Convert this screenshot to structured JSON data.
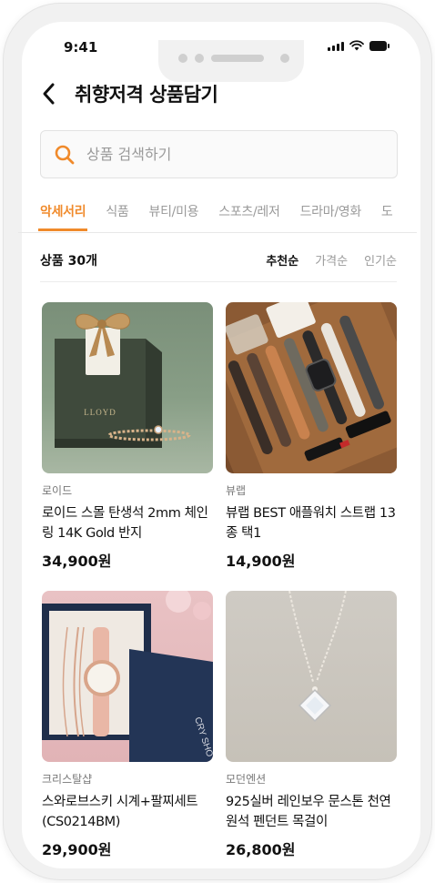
{
  "status_bar": {
    "time": "9:41"
  },
  "header": {
    "title": "취향저격 상품담기"
  },
  "search": {
    "placeholder": "상품 검색하기",
    "value": ""
  },
  "tabs": [
    {
      "label": "악세서리",
      "active": true
    },
    {
      "label": "식품",
      "active": false
    },
    {
      "label": "뷰티/미용",
      "active": false
    },
    {
      "label": "스포츠/레저",
      "active": false
    },
    {
      "label": "드라마/영화",
      "active": false
    },
    {
      "label": "도",
      "active": false
    }
  ],
  "list": {
    "count_label": "상품 30개",
    "sort_options": [
      {
        "label": "추천순",
        "active": true
      },
      {
        "label": "가격순",
        "active": false
      },
      {
        "label": "인기순",
        "active": false
      }
    ]
  },
  "products": [
    {
      "brand": "로이드",
      "name": "로이드 스몰 탄생석 2mm 체인링 14K Gold 반지",
      "price": "34,900원",
      "image_text": "LLOYD"
    },
    {
      "brand": "뷰랩",
      "name": "뷰랩 BEST 애플워치 스트랩 13종 택1",
      "price": "14,900원"
    },
    {
      "brand": "크리스탈샵",
      "name": "스와로브스키 시계+팔찌세트(CS0214BM)",
      "price": "29,900원",
      "image_text": "CRY SHO"
    },
    {
      "brand": "모던엔션",
      "name": "925실버 레인보우 문스톤 천연원석 펜던트 목걸이",
      "price": "26,800원"
    }
  ],
  "colors": {
    "accent": "#f08a2b"
  }
}
